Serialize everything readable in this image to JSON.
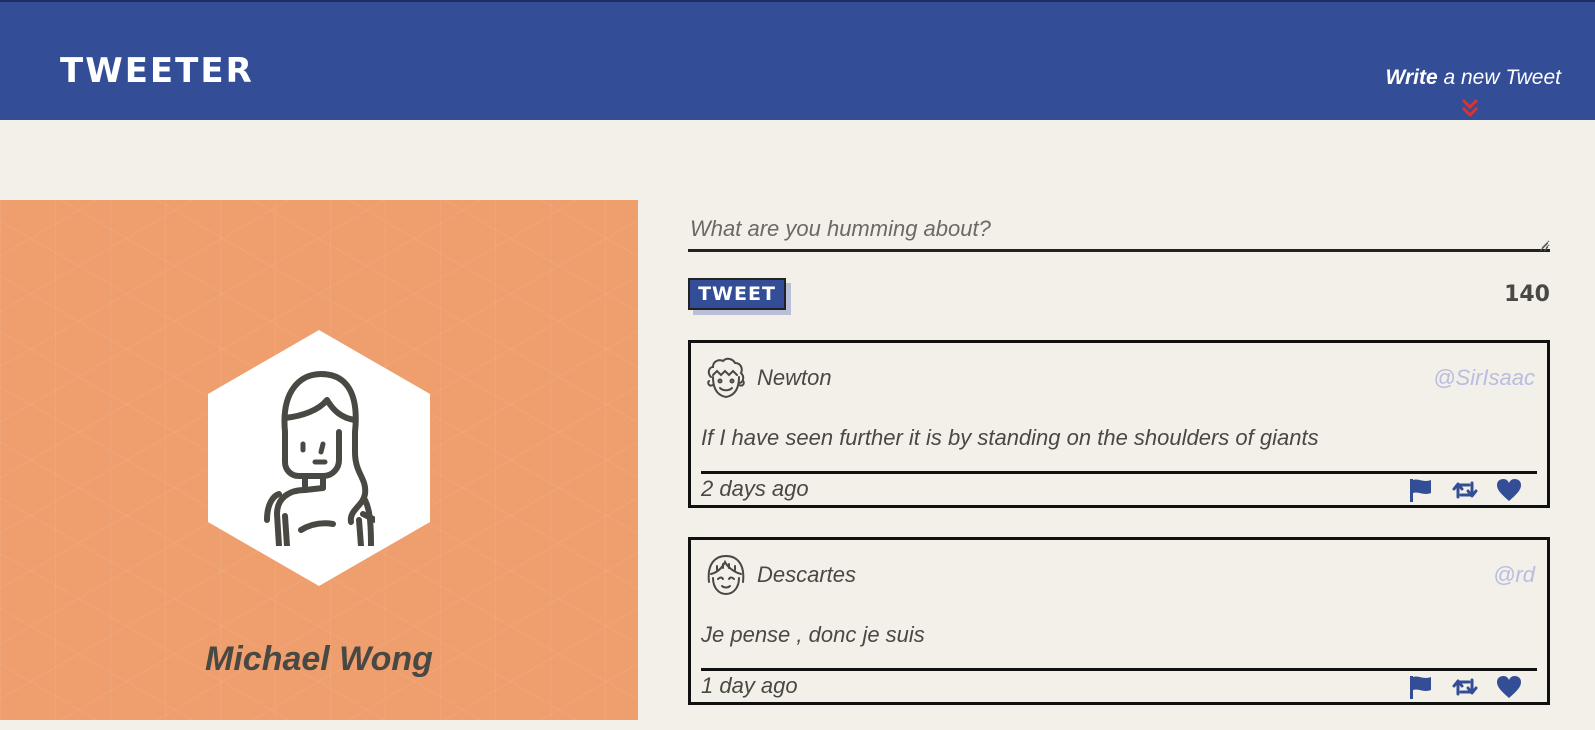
{
  "header": {
    "brand": "Tweeter",
    "compose_toggle_bold": "Write",
    "compose_toggle_rest": " a new Tweet",
    "chevron_icon": "double-chevron-down-icon",
    "chevron_color": "#e0322d"
  },
  "profile": {
    "name": "Michael Wong",
    "avatar_icon": "woman-avatar-icon",
    "background_color": "#ef9e6e"
  },
  "compose": {
    "placeholder": "What are you humming about?",
    "button_label": "Tweet",
    "counter": "140"
  },
  "tweets": [
    {
      "author": "Newton",
      "handle": "@SirIsaac",
      "avatar_icon": "curly-hair-man-avatar-icon",
      "text": "If I have seen further it is by standing on the shoulders of giants",
      "time": "2 days ago"
    },
    {
      "author": "Descartes",
      "handle": "@rd",
      "avatar_icon": "bob-hair-avatar-icon",
      "text": "Je pense , donc je suis",
      "time": "1 day ago"
    }
  ],
  "actions": {
    "flag_icon": "flag-icon",
    "retweet_icon": "retweet-icon",
    "like_icon": "heart-icon",
    "icon_color": "#334d96"
  },
  "colors": {
    "nav": "#334d96",
    "page_bg": "#f3efe9",
    "text": "#4a4842",
    "handle": "#b9bde0"
  }
}
